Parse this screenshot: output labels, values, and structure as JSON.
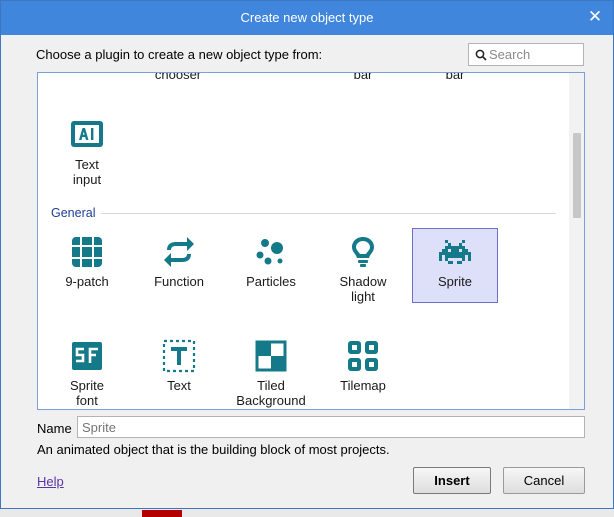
{
  "window": {
    "title": "Create new object type",
    "close_glyph": "✕"
  },
  "prompt": "Choose a plugin to create a new object type from:",
  "search": {
    "placeholder": "Search",
    "value": ""
  },
  "partial_row": [
    "chooser",
    "bar",
    "bar"
  ],
  "top_items": [
    {
      "label_lines": [
        "Text",
        "input"
      ],
      "icon": "text-input-icon"
    }
  ],
  "section": {
    "title": "General"
  },
  "general_items": [
    {
      "label_lines": [
        "9-patch"
      ],
      "icon": "nine-patch-icon",
      "selected": false
    },
    {
      "label_lines": [
        "Function"
      ],
      "icon": "function-icon",
      "selected": false
    },
    {
      "label_lines": [
        "Particles"
      ],
      "icon": "particles-icon",
      "selected": false
    },
    {
      "label_lines": [
        "Shadow",
        "light"
      ],
      "icon": "shadow-light-icon",
      "selected": false
    },
    {
      "label_lines": [
        "Sprite"
      ],
      "icon": "sprite-icon",
      "selected": true
    },
    {
      "label_lines": [
        "Sprite",
        "font"
      ],
      "icon": "sprite-font-icon",
      "selected": false
    },
    {
      "label_lines": [
        "Text"
      ],
      "icon": "text-icon",
      "selected": false
    },
    {
      "label_lines": [
        "Tiled",
        "Background"
      ],
      "icon": "tiled-background-icon",
      "selected": false
    },
    {
      "label_lines": [
        "Tilemap"
      ],
      "icon": "tilemap-icon",
      "selected": false
    }
  ],
  "name": {
    "label": "Name",
    "placeholder": "Sprite",
    "value": ""
  },
  "description": "An animated object that is the building block of most projects.",
  "help_link": "Help",
  "buttons": {
    "insert": "Insert",
    "cancel": "Cancel"
  },
  "colors": {
    "accent": "#3f86dc",
    "icon": "#147a8a",
    "selection": "#dedff9",
    "section_text": "#1f3f97"
  }
}
